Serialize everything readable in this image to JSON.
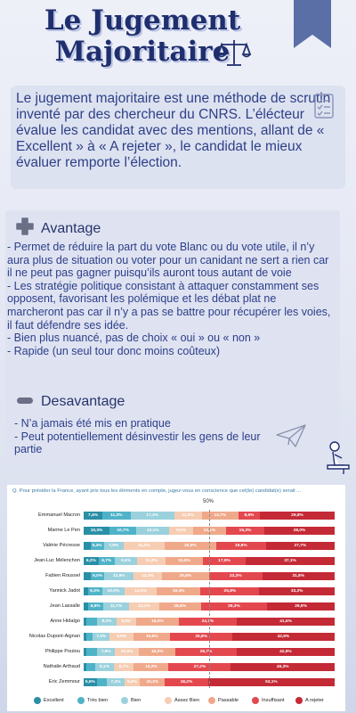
{
  "title": "Le Jugement Majoritaire",
  "intro": "Le jugement majoritaire est une méthode de scrutin inventé par des chercheur du CNRS. L’élécteur évalue les candidat avec des mentions, allant de « Excellent » à « A rejeter », le candidat le mieux évaluer remporte l’élection.",
  "advantages": {
    "heading": "Avantage",
    "items": [
      "- Permet de réduire la part du vote Blanc ou du vote utile, il n’y aura plus de situation ou voter pour un canidant ne sert a rien car il ne peut pas gagner puisqu’ils auront tous autant de voie",
      "- Les stratégie politique consistant à attaquer constamment ses opposent, favorisant les polémique et les débat plat ne marcheront pas car il n’y a pas se battre pour récupérer les voies, il faut défendre ses idée.",
      "- Bien plus nuancé, pas de choix « oui » ou « non »",
      "- Rapide (un seul tour donc moins coûteux)"
    ]
  },
  "disadvantages": {
    "heading": "Desavantage",
    "items": [
      "- N’a jamais été mis en pratique",
      "- Peut potentiellement désinvestir les gens de leur partie"
    ]
  },
  "icons": [
    "scale-icon",
    "document-checklist-icon",
    "plus-icon",
    "minus-icon",
    "paper-plane-icon",
    "person-icon"
  ],
  "chart_data": {
    "type": "bar",
    "stacked": true,
    "title": "Q. Pour présider la France, ayant pris tous les éléments en compte, jugez-vous en conscience que cet(te) candidat(e) serait ...",
    "median_label": "50%",
    "categories": [
      "Emmanuel Macron",
      "Marine Le Pen",
      "Valérie Pécresse",
      "Jean-Luc Mélenchon",
      "Fabien Roussel",
      "Yannick Jadot",
      "Jean Lassalle",
      "Anne Hidalgo",
      "Nicolas Dupont-Aignan",
      "Philippe Poutou",
      "Nathalie Arthaud",
      "Eric Zemmour"
    ],
    "legend": [
      "Excellent",
      "Très bien",
      "Bien",
      "Assez Bien",
      "Passable",
      "Insuffisant",
      "A rejeter"
    ],
    "colors": [
      "#2a8fa6",
      "#4fb3c8",
      "#9ad1dd",
      "#f6cdb3",
      "#efa98a",
      "#e4484f",
      "#c42a36"
    ],
    "series": [
      {
        "name": "Excellent",
        "values": [
          7.4,
          10.3,
          2.7,
          6.2,
          3.1,
          1.8,
          1.9,
          1.1,
          1.1,
          1.3,
          1.1,
          5.5
        ]
      },
      {
        "name": "Très bien",
        "values": [
          11.3,
          10.7,
          5.4,
          6.7,
          6.0,
          6.3,
          6.6,
          4.7,
          2.8,
          4.5,
          4.0,
          4.3
        ]
      },
      {
        "name": "Bien",
        "values": [
          17.3,
          13.1,
          7.9,
          9.5,
          12.9,
          10.0,
          11.7,
          8.0,
          7.0,
          7.9,
          8.1,
          7.3
        ]
      },
      {
        "name": "Assez Bien",
        "values": [
          11.0,
          9.5,
          16.4,
          11.8,
          12.3,
          14.0,
          13.1,
          8.5,
          9.9,
          10.5,
          8.7,
          6.6
        ]
      },
      {
        "name": "Passable",
        "values": [
          14.7,
          13.1,
          20.9,
          15.5,
          20.8,
          19.4,
          18.6,
          18.0,
          15.5,
          16.0,
          15.2,
          10.3
        ]
      },
      {
        "name": "Insuffisant",
        "values": [
          8.5,
          15.3,
          19.8,
          17.9,
          23.3,
          25.8,
          29.3,
          24.7,
          25.8,
          26.7,
          27.2,
          18.2
        ]
      },
      {
        "name": "A rejeter",
        "values": [
          29.8,
          28.0,
          27.7,
          37.1,
          31.8,
          33.2,
          29.9,
          41.5,
          42.9,
          42.9,
          45.3,
          53.1
        ]
      }
    ],
    "xlim": [
      0,
      100
    ]
  }
}
